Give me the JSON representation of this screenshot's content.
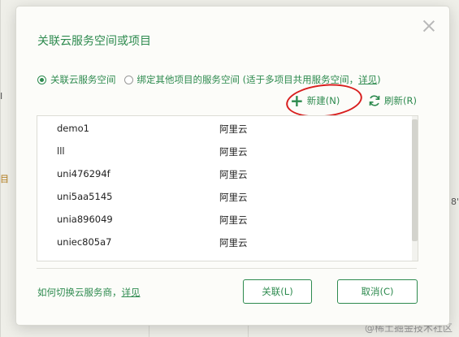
{
  "background": {
    "fragments": [
      "I",
      "目",
      "8'"
    ]
  },
  "watermark": "@稀土掘金技术社区",
  "dialog": {
    "title": "关联云服务空间或项目",
    "radio_options": [
      {
        "label": "关联云服务空间",
        "checked": true
      },
      {
        "label": "绑定其他项目的服务空间 (适于多项目共用服务空间，",
        "link": "详见",
        "suffix": ")",
        "checked": false
      }
    ],
    "actions": {
      "new_label": "新建(N)",
      "refresh_label": "刷新(R)"
    },
    "spaces": [
      {
        "name": "demo1",
        "provider": "阿里云"
      },
      {
        "name": "lll",
        "provider": "阿里云"
      },
      {
        "name": "uni476294f",
        "provider": "阿里云"
      },
      {
        "name": "uni5aa5145",
        "provider": "阿里云"
      },
      {
        "name": "unia896049",
        "provider": "阿里云"
      },
      {
        "name": "uniec805a7",
        "provider": "阿里云"
      }
    ],
    "footer": {
      "text": "如何切换云服务商，",
      "link": "详见"
    },
    "buttons": {
      "ok": "关联(L)",
      "cancel": "取消(C)"
    }
  },
  "colors": {
    "accent": "#2d8a4e",
    "annotation": "#d81e1e"
  }
}
